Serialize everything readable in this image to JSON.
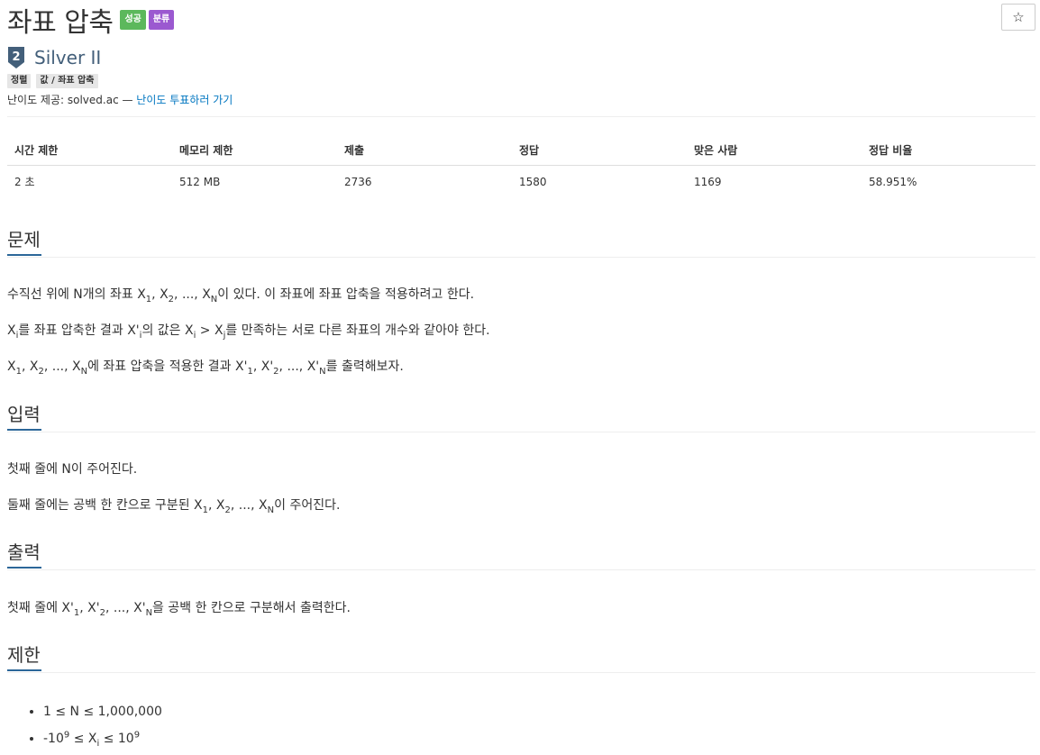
{
  "problem": {
    "title": "좌표 압축",
    "badges": {
      "success": "성공",
      "classified": "분류"
    },
    "star": "☆",
    "tier": {
      "number": "2",
      "name": "Silver II",
      "color": "#435f7a"
    },
    "tags": [
      "정렬",
      "값 / 좌표 압축"
    ],
    "credit": {
      "prefix": "난이도 제공: solved.ac — ",
      "link": "난이도 투표하러 가기"
    }
  },
  "stats": {
    "headers": [
      "시간 제한",
      "메모리 제한",
      "제출",
      "정답",
      "맞은 사람",
      "정답 비율"
    ],
    "values": [
      "2 초",
      "512 MB",
      "2736",
      "1580",
      "1169",
      "58.951%"
    ]
  },
  "sections": {
    "description": "문제",
    "input": "입력",
    "output": "출력",
    "limit": "제한"
  },
  "description": {
    "p1": {
      "a": "수직선 위에 N개의 좌표 X",
      "s1": "1",
      "b": ", X",
      "s2": "2",
      "c": ", ..., X",
      "s3": "N",
      "d": "이 있다. 이 좌표에 좌표 압축을 적용하려고 한다."
    },
    "p2": {
      "a": "X",
      "s1": "i",
      "b": "를 좌표 압축한 결과 X'",
      "s2": "i",
      "c": "의 값은 X",
      "s3": "i",
      "d": " > X",
      "s4": "j",
      "e": "를 만족하는 서로 다른 좌표의 개수와 같아야 한다."
    },
    "p3": {
      "a": "X",
      "s1": "1",
      "b": ", X",
      "s2": "2",
      "c": ", ..., X",
      "s3": "N",
      "d": "에 좌표 압축을 적용한 결과 X'",
      "s4": "1",
      "e": ", X'",
      "s5": "2",
      "f": ", ..., X'",
      "s6": "N",
      "g": "를 출력해보자."
    }
  },
  "input": {
    "p1": "첫째 줄에 N이 주어진다.",
    "p2": {
      "a": "둘째 줄에는 공백 한 칸으로 구분된 X",
      "s1": "1",
      "b": ", X",
      "s2": "2",
      "c": ", ..., X",
      "s3": "N",
      "d": "이 주어진다."
    }
  },
  "output": {
    "p1": {
      "a": "첫째 줄에 X'",
      "s1": "1",
      "b": ", X'",
      "s2": "2",
      "c": ", ..., X'",
      "s3": "N",
      "d": "을 공백 한 칸으로 구분해서 출력한다."
    }
  },
  "limits": {
    "l1": "1 ≤ N ≤ 1,000,000",
    "l2": {
      "a": "-10",
      "e1": "9",
      "b": " ≤ X",
      "s1": "i",
      "c": " ≤ 10",
      "e2": "9"
    }
  }
}
